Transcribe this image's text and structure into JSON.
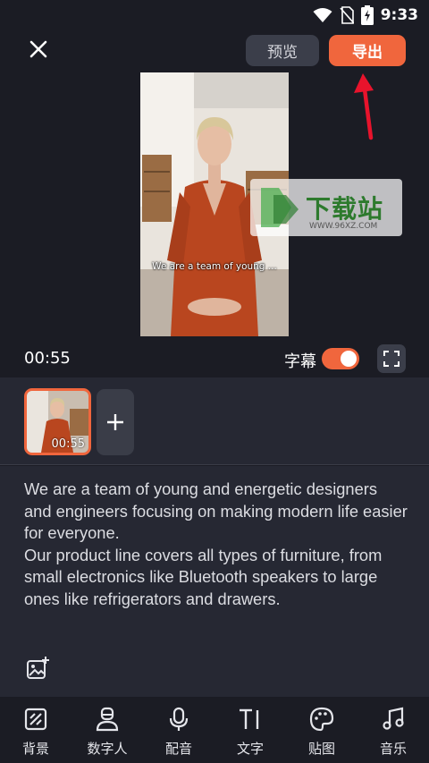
{
  "status_bar": {
    "time": "9:33",
    "icons": [
      "wifi-icon",
      "no-sim-icon",
      "battery-charging-icon"
    ]
  },
  "top_bar": {
    "close_icon": "close-icon",
    "preview_label": "预览",
    "export_label": "导出"
  },
  "video": {
    "subtitle_overlay": "We are a team of young ..."
  },
  "watermark": {
    "text": "下载站",
    "url": "WWW.96XZ.COM"
  },
  "player": {
    "time": "00:55",
    "subtitle_label": "字幕",
    "subtitle_enabled": true,
    "fullscreen_icon": "fullscreen-icon"
  },
  "clips": {
    "items": [
      {
        "duration": "00:55"
      }
    ],
    "add_icon": "plus-icon"
  },
  "script": {
    "text": "We are a team of young and energetic designers and engineers focusing on making modern life easier for everyone.\nOur product line covers all types of furniture, from small electronics like Bluetooth speakers to large ones like refrigerators and drawers."
  },
  "bottom_nav": {
    "items": [
      {
        "label": "背景",
        "icon": "background-icon"
      },
      {
        "label": "数字人",
        "icon": "digital-human-icon"
      },
      {
        "label": "配音",
        "icon": "microphone-icon"
      },
      {
        "label": "文字",
        "icon": "text-icon"
      },
      {
        "label": "贴图",
        "icon": "sticker-icon"
      },
      {
        "label": "音乐",
        "icon": "music-icon"
      }
    ]
  },
  "colors": {
    "accent": "#f0663d",
    "background": "#1b1c24",
    "panel": "#262833"
  }
}
